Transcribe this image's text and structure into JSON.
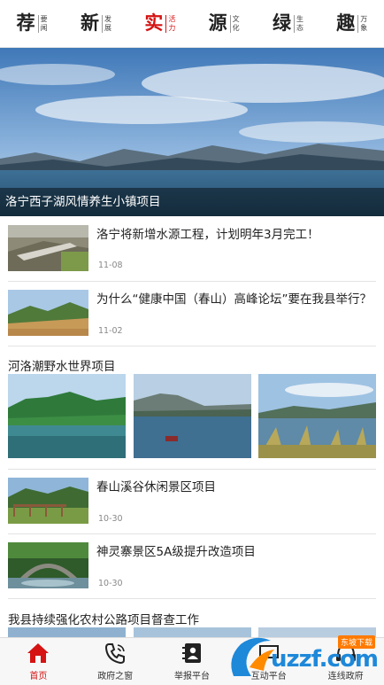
{
  "topnav": {
    "tabs": [
      {
        "big": "荐",
        "small1": "要",
        "small2": "闻"
      },
      {
        "big": "新",
        "small1": "发",
        "small2": "展"
      },
      {
        "big": "实",
        "small1": "活",
        "small2": "力"
      },
      {
        "big": "源",
        "small1": "文",
        "small2": "化"
      },
      {
        "big": "绿",
        "small1": "生",
        "small2": "态"
      },
      {
        "big": "趣",
        "small1": "万",
        "small2": "象"
      }
    ],
    "active_index": 2,
    "accent_color": "#d51313"
  },
  "hero": {
    "caption": "洛宁西子湖风情养生小镇项目"
  },
  "news": [
    {
      "title": "洛宁将新增水源工程，计划明年3月完工！",
      "date": "11-08"
    },
    {
      "title": "为什么“健康中国（春山）高峰论坛”要在我县举行？",
      "date": "11-02"
    }
  ],
  "gallery": {
    "title": "河洛潮野水世界项目"
  },
  "news2": [
    {
      "title": "春山溪谷休闲景区项目",
      "date": "10-30"
    },
    {
      "title": "神灵寨景区5A级提升改造项目",
      "date": "10-30"
    }
  ],
  "partial_item": {
    "title": "我县持续强化农村公路项目督查工作"
  },
  "bottombar": {
    "items": [
      {
        "label": "首页",
        "icon": "home-icon"
      },
      {
        "label": "政府之窗",
        "icon": "phone-icon"
      },
      {
        "label": "举报平台",
        "icon": "contacts-icon"
      },
      {
        "label": "互动平台",
        "icon": "chat-icon"
      },
      {
        "label": "连线政府",
        "icon": "headset-icon"
      }
    ],
    "active_index": 0
  },
  "watermark": {
    "text": "uzzf.com",
    "tag": "东坡下载"
  }
}
